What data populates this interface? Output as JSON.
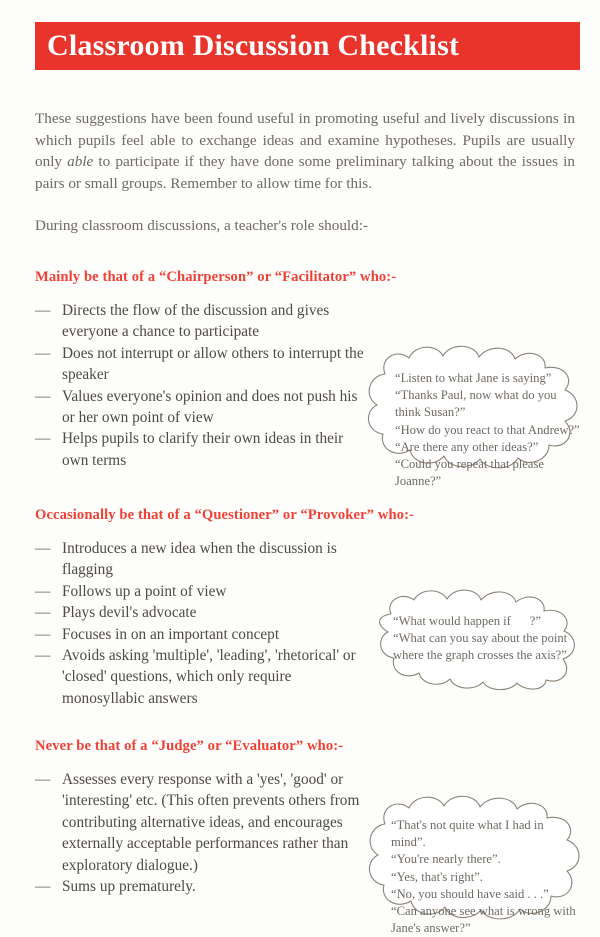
{
  "document": {
    "title": "Classroom Discussion Checklist",
    "accent_color": "#e8342a",
    "heading_color": "#ef4136",
    "body_text_color": "#6f6962",
    "bullet_text_color": "#4f4a44",
    "page_background": "#fdfdfb"
  },
  "intro": {
    "paragraph_1": "These suggestions have been found useful in promoting useful and lively discussions in which pupils feel able to exchange ideas and examine hypotheses. Pupils are usually only ",
    "paragraph_1_emphasis": "able",
    "paragraph_1_cont": " to participate if they have done some preliminary talking about the issues in pairs or small groups. Remember to allow time for this.",
    "paragraph_2": "During classroom discussions, a teacher's role should:-"
  },
  "sections": [
    {
      "heading": "Mainly be that of a “Chairperson” or “Facilitator” who:-",
      "bullets": [
        "Directs the flow of the discussion and gives everyone a chance to participate",
        "Does not interrupt or allow others to interrupt the speaker",
        "Values everyone's opinion and does not push his or her own point of view",
        "Helps pupils to clarify their own ideas in their own terms"
      ],
      "bullet_marker": "—",
      "bubble": {
        "lines": [
          "“Listen to what Jane is saying”",
          "“Thanks Paul, now what do you",
          "think Susan?”",
          "“How do you react to that Andrew?”",
          "“Are there any other ideas?”",
          "“Could you repeat that please",
          "Joanne?”"
        ]
      }
    },
    {
      "heading": "Occasionally be that of a “Questioner” or “Provoker” who:-",
      "bullets": [
        "Introduces a new idea when the discussion is flagging",
        "Follows up a point of view",
        "Plays devil's advocate",
        "Focuses in on an important concept",
        "Avoids asking 'multiple', 'leading', 'rhetorical' or 'closed' questions, which only require monosyllabic answers"
      ],
      "bullet_marker": "—",
      "bubble": {
        "lines": [
          "“What would happen if      ?”",
          "“What can you say about the point",
          "where the graph crosses the axis?”"
        ]
      }
    },
    {
      "heading": "Never be that of a “Judge” or “Evaluator” who:-",
      "bullets": [
        "Assesses every response with a 'yes', 'good' or 'interesting' etc. (This often prevents others from contributing alternative ideas, and encourages externally acceptable performances rather than exploratory dialogue.)",
        "Sums up prematurely."
      ],
      "bullet_marker": "—",
      "bubble": {
        "lines": [
          "“That's not quite what I had in",
          "mind”.",
          "“You're nearly there”.",
          "“Yes, that's right”.",
          "“No, you should have said . . .”",
          "“Can anyone see what is wrong with",
          "Jane's answer?”"
        ]
      }
    }
  ]
}
